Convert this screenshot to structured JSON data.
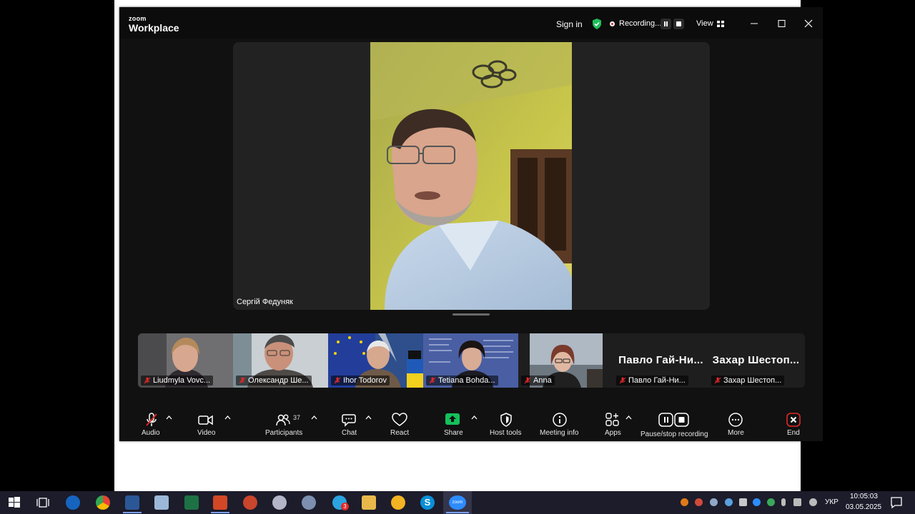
{
  "window": {
    "logo_small": "zoom",
    "logo_big": "Workplace",
    "sign_in": "Sign in",
    "recording_label": "Recording...",
    "view_label": "View"
  },
  "stage": {
    "active_speaker": "Сергій Федуняк"
  },
  "filmstrip": {
    "tiles": [
      {
        "label": "Liudmyla Vovc...",
        "muted": true
      },
      {
        "label": "Олександр Ше...",
        "muted": true
      },
      {
        "label": "Ihor Todorov",
        "muted": true
      },
      {
        "label": "Tetiana Bohda...",
        "muted": true
      },
      {
        "label": "Anna",
        "muted": true
      },
      {
        "label": "Павло Гай-Ни...",
        "big_name": "Павло Гай-Ни...",
        "muted": true
      },
      {
        "label": "Захар Шестоп...",
        "big_name": "Захар Шестоп...",
        "muted": true
      }
    ]
  },
  "toolbar": {
    "audio": "Audio",
    "video": "Video",
    "participants": "Participants",
    "participants_count": "37",
    "chat": "Chat",
    "react": "React",
    "share": "Share",
    "host_tools": "Host tools",
    "meeting_info": "Meeting info",
    "apps": "Apps",
    "pause_stop_recording": "Pause/stop recording",
    "more": "More",
    "end": "End"
  },
  "taskbar": {
    "language": "УКР",
    "time": "10:05:03",
    "date": "03.05.2025",
    "telegram_badge": "3",
    "zoom_label": "zoom"
  },
  "colors": {
    "share_green": "#14c15a",
    "end_red": "#e02828",
    "shield_green": "#1fbf5b"
  }
}
